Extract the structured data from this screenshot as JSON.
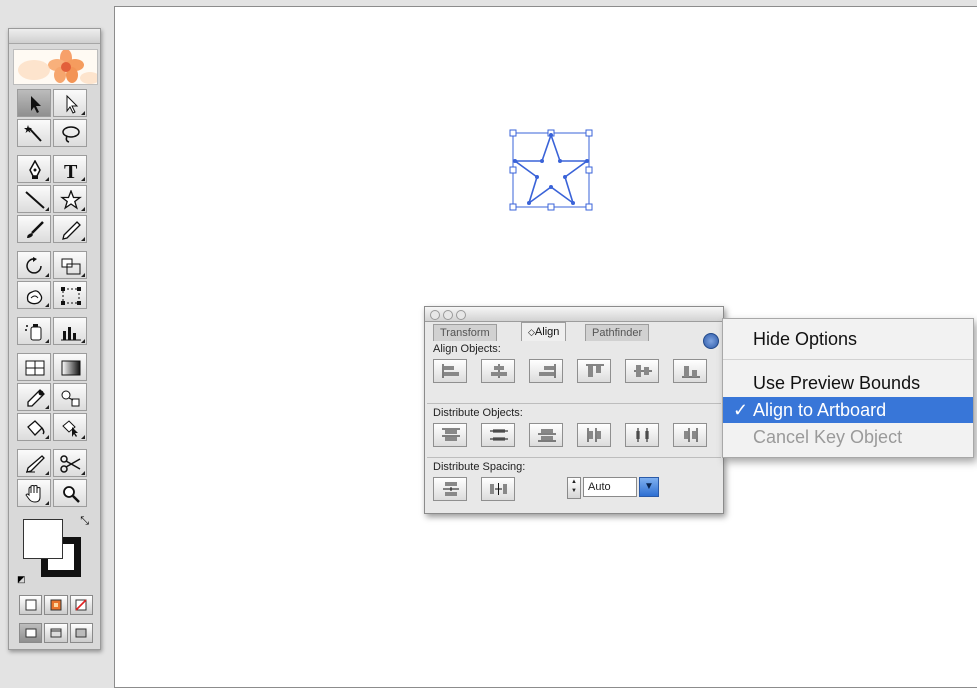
{
  "tools_panel": {
    "tools": [
      {
        "name": "selection-tool",
        "active": true
      },
      {
        "name": "direct-selection-tool"
      },
      {
        "name": "magic-wand-tool"
      },
      {
        "name": "lasso-tool"
      },
      {
        "name": "pen-tool"
      },
      {
        "name": "type-tool",
        "glyph": "T"
      },
      {
        "name": "line-segment-tool"
      },
      {
        "name": "star-tool"
      },
      {
        "name": "paintbrush-tool"
      },
      {
        "name": "pencil-tool"
      },
      {
        "name": "rotate-tool"
      },
      {
        "name": "scale-tool"
      },
      {
        "name": "warp-tool"
      },
      {
        "name": "free-transform-tool"
      },
      {
        "name": "symbol-sprayer-tool"
      },
      {
        "name": "column-graph-tool"
      },
      {
        "name": "mesh-tool"
      },
      {
        "name": "gradient-tool"
      },
      {
        "name": "eyedropper-tool"
      },
      {
        "name": "blend-tool"
      },
      {
        "name": "live-paint-bucket-tool"
      },
      {
        "name": "live-paint-selection-tool"
      },
      {
        "name": "slice-tool"
      },
      {
        "name": "scissors-tool"
      },
      {
        "name": "hand-tool"
      },
      {
        "name": "zoom-tool"
      }
    ]
  },
  "align_panel": {
    "tabs": [
      "Transform",
      "Align",
      "Pathfinder"
    ],
    "active_tab": "Align",
    "sections": {
      "align_objects": "Align Objects:",
      "distribute_objects": "Distribute Objects:",
      "distribute_spacing": "Distribute Spacing:"
    },
    "spacing_value": "Auto"
  },
  "options_menu": {
    "items": [
      {
        "label": "Hide Options",
        "state": "normal"
      },
      {
        "label": "Use Preview Bounds",
        "state": "normal"
      },
      {
        "label": "Align to Artboard",
        "state": "selected",
        "checked": true,
        "check": "✓"
      },
      {
        "label": "Cancel Key Object",
        "state": "disabled"
      }
    ]
  },
  "colors": {
    "menu_highlight": "#3876d8",
    "selection_blue": "#3a63d8",
    "options_button_blue": "#2c59a8"
  }
}
